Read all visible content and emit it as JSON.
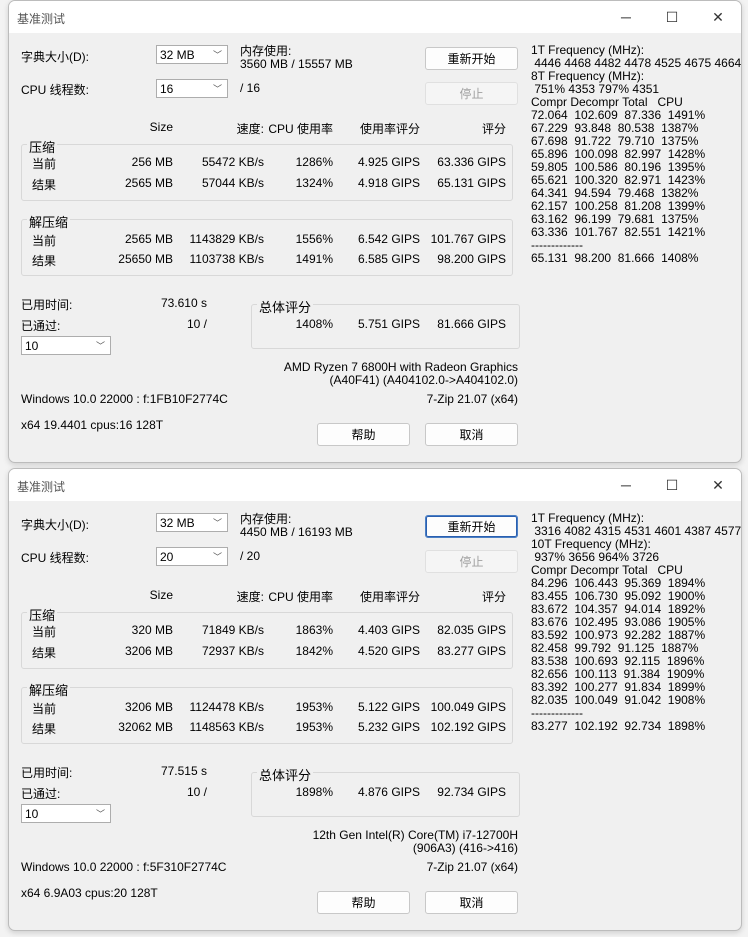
{
  "labels": {
    "title": "基准测试",
    "dict": "字典大小(D):",
    "threads": "CPU 线程数:",
    "mem": "内存使用:",
    "restart": "重新开始",
    "stop": "停止",
    "h_size": "Size",
    "h_speed": "速度:",
    "h_cpu": "CPU 使用率",
    "h_rating": "使用率评分",
    "h_score": "评分",
    "compress": "压缩",
    "decompress": "解压缩",
    "current": "当前",
    "result": "结果",
    "elapsed": "已用时间:",
    "passed": "已通过:",
    "overall": "总体评分",
    "help": "帮助",
    "cancel": "取消",
    "minimize": "─",
    "maximize": "☐",
    "close": "✕",
    "chev": "﹀"
  },
  "windows": [
    {
      "dict": "32 MB",
      "threads": "16",
      "mem": "3560 MB / 15557 MB",
      "threads_max": "/ 16",
      "comp_cur": [
        "256 MB",
        "55472 KB/s",
        "1286%",
        "4.925 GIPS",
        "63.336 GIPS"
      ],
      "comp_res": [
        "2565 MB",
        "57044 KB/s",
        "1324%",
        "4.918 GIPS",
        "65.131 GIPS"
      ],
      "dec_cur": [
        "2565 MB",
        "1143829 KB/s",
        "1556%",
        "6.542 GIPS",
        "101.767 GIPS"
      ],
      "dec_res": [
        "25650 MB",
        "1103738 KB/s",
        "1491%",
        "6.585 GIPS",
        "98.200 GIPS"
      ],
      "elapsed": "73.610 s",
      "passed": "10 /",
      "passes": "10",
      "overall": [
        "1408%",
        "5.751 GIPS",
        "81.666 GIPS"
      ],
      "cpu1": "AMD Ryzen 7 6800H with Radeon Graphics",
      "cpu2": "(A40F41) (A404102.0->A404102.0)",
      "os": "Windows 10.0 22000 : f:1FB10F2774C",
      "ver": "7-Zip 21.07 (x64)",
      "arch": "x64 19.4401 cpus:16 128T",
      "side": [
        "1T Frequency (MHz):",
        " 4446 4468 4482 4478 4525 4675 4664",
        "8T Frequency (MHz):",
        " 751% 4353 797% 4351",
        "Compr Decompr Total   CPU",
        "72.064  102.609  87.336  1491%",
        "67.229  93.848  80.538  1387%",
        "67.698  91.722  79.710  1375%",
        "65.896  100.098  82.997  1428%",
        "59.805  100.586  80.196  1395%",
        "65.621  100.320  82.971  1423%",
        "64.341  94.594  79.468  1382%",
        "62.157  100.258  81.208  1399%",
        "63.162  96.199  79.681  1375%",
        "63.336  101.767  82.551  1421%",
        "-------------",
        "65.131  98.200  81.666  1408%"
      ]
    },
    {
      "dict": "32 MB",
      "threads": "20",
      "mem": "4450 MB / 16193 MB",
      "threads_max": "/ 20",
      "comp_cur": [
        "320 MB",
        "71849 KB/s",
        "1863%",
        "4.403 GIPS",
        "82.035 GIPS"
      ],
      "comp_res": [
        "3206 MB",
        "72937 KB/s",
        "1842%",
        "4.520 GIPS",
        "83.277 GIPS"
      ],
      "dec_cur": [
        "3206 MB",
        "1124478 KB/s",
        "1953%",
        "5.122 GIPS",
        "100.049 GIPS"
      ],
      "dec_res": [
        "32062 MB",
        "1148563 KB/s",
        "1953%",
        "5.232 GIPS",
        "102.192 GIPS"
      ],
      "elapsed": "77.515 s",
      "passed": "10 /",
      "passes": "10",
      "overall": [
        "1898%",
        "4.876 GIPS",
        "92.734 GIPS"
      ],
      "cpu1": "12th Gen Intel(R) Core(TM) i7-12700H",
      "cpu2": "(906A3) (416->416)",
      "os": "Windows 10.0 22000 : f:5F310F2774C",
      "ver": "7-Zip 21.07 (x64)",
      "arch": "x64 6.9A03 cpus:20 128T",
      "side": [
        "1T Frequency (MHz):",
        " 3316 4082 4315 4531 4601 4387 4577",
        "10T Frequency (MHz):",
        " 937% 3656 964% 3726",
        "Compr Decompr Total   CPU",
        "84.296  106.443  95.369  1894%",
        "83.455  106.730  95.092  1900%",
        "83.672  104.357  94.014  1892%",
        "83.676  102.495  93.086  1905%",
        "83.592  100.973  92.282  1887%",
        "82.458  99.792  91.125  1887%",
        "83.538  100.693  92.115  1896%",
        "82.656  100.113  91.384  1909%",
        "83.392  100.277  91.834  1899%",
        "82.035  100.049  91.042  1908%",
        "-------------",
        "83.277  102.192  92.734  1898%"
      ]
    }
  ]
}
